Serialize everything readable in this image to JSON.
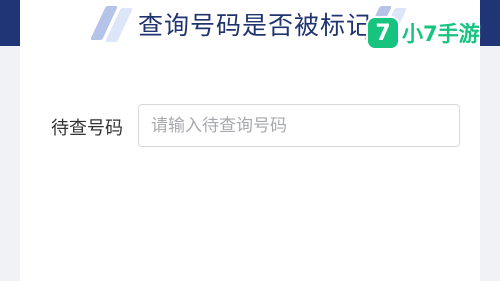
{
  "header": {
    "title": "查询号码是否被标记"
  },
  "form": {
    "label": "待查号码",
    "placeholder": "请输入待查询号码",
    "value": ""
  },
  "watermark": {
    "logo_glyph": "7",
    "text": "小7手游"
  },
  "colors": {
    "header_band": "#1f3576",
    "title": "#20356f",
    "brand": "#16c47f",
    "background": "#f1f2f6"
  }
}
